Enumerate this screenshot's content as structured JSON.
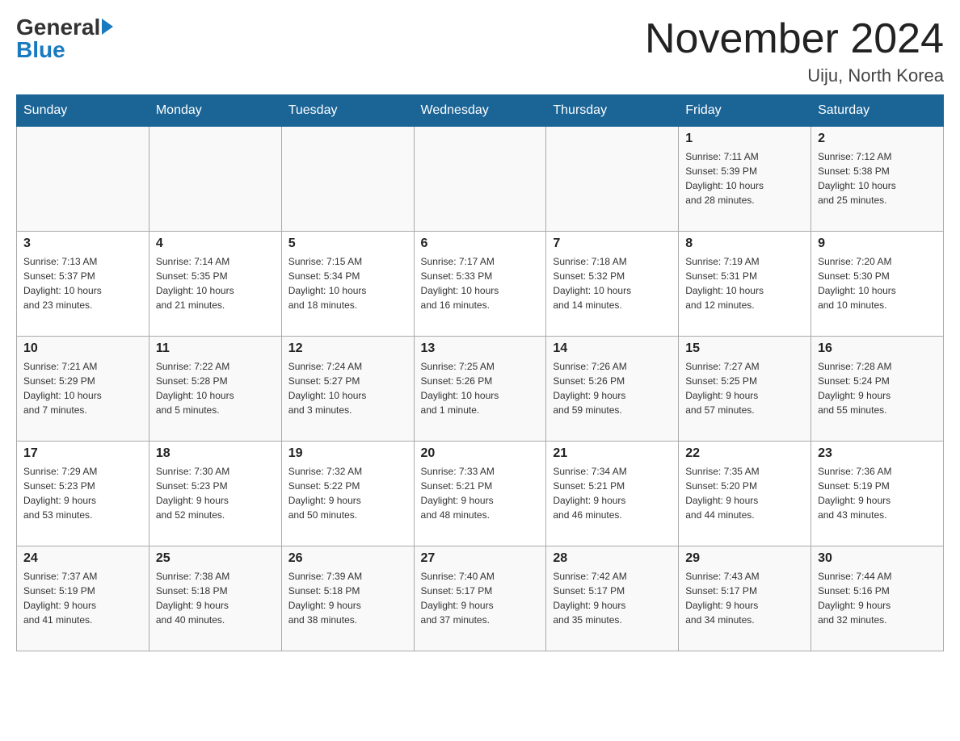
{
  "logo": {
    "general": "General",
    "blue": "Blue"
  },
  "title": "November 2024",
  "location": "Uiju, North Korea",
  "days_of_week": [
    "Sunday",
    "Monday",
    "Tuesday",
    "Wednesday",
    "Thursday",
    "Friday",
    "Saturday"
  ],
  "weeks": [
    [
      {
        "day": "",
        "info": ""
      },
      {
        "day": "",
        "info": ""
      },
      {
        "day": "",
        "info": ""
      },
      {
        "day": "",
        "info": ""
      },
      {
        "day": "",
        "info": ""
      },
      {
        "day": "1",
        "info": "Sunrise: 7:11 AM\nSunset: 5:39 PM\nDaylight: 10 hours\nand 28 minutes."
      },
      {
        "day": "2",
        "info": "Sunrise: 7:12 AM\nSunset: 5:38 PM\nDaylight: 10 hours\nand 25 minutes."
      }
    ],
    [
      {
        "day": "3",
        "info": "Sunrise: 7:13 AM\nSunset: 5:37 PM\nDaylight: 10 hours\nand 23 minutes."
      },
      {
        "day": "4",
        "info": "Sunrise: 7:14 AM\nSunset: 5:35 PM\nDaylight: 10 hours\nand 21 minutes."
      },
      {
        "day": "5",
        "info": "Sunrise: 7:15 AM\nSunset: 5:34 PM\nDaylight: 10 hours\nand 18 minutes."
      },
      {
        "day": "6",
        "info": "Sunrise: 7:17 AM\nSunset: 5:33 PM\nDaylight: 10 hours\nand 16 minutes."
      },
      {
        "day": "7",
        "info": "Sunrise: 7:18 AM\nSunset: 5:32 PM\nDaylight: 10 hours\nand 14 minutes."
      },
      {
        "day": "8",
        "info": "Sunrise: 7:19 AM\nSunset: 5:31 PM\nDaylight: 10 hours\nand 12 minutes."
      },
      {
        "day": "9",
        "info": "Sunrise: 7:20 AM\nSunset: 5:30 PM\nDaylight: 10 hours\nand 10 minutes."
      }
    ],
    [
      {
        "day": "10",
        "info": "Sunrise: 7:21 AM\nSunset: 5:29 PM\nDaylight: 10 hours\nand 7 minutes."
      },
      {
        "day": "11",
        "info": "Sunrise: 7:22 AM\nSunset: 5:28 PM\nDaylight: 10 hours\nand 5 minutes."
      },
      {
        "day": "12",
        "info": "Sunrise: 7:24 AM\nSunset: 5:27 PM\nDaylight: 10 hours\nand 3 minutes."
      },
      {
        "day": "13",
        "info": "Sunrise: 7:25 AM\nSunset: 5:26 PM\nDaylight: 10 hours\nand 1 minute."
      },
      {
        "day": "14",
        "info": "Sunrise: 7:26 AM\nSunset: 5:26 PM\nDaylight: 9 hours\nand 59 minutes."
      },
      {
        "day": "15",
        "info": "Sunrise: 7:27 AM\nSunset: 5:25 PM\nDaylight: 9 hours\nand 57 minutes."
      },
      {
        "day": "16",
        "info": "Sunrise: 7:28 AM\nSunset: 5:24 PM\nDaylight: 9 hours\nand 55 minutes."
      }
    ],
    [
      {
        "day": "17",
        "info": "Sunrise: 7:29 AM\nSunset: 5:23 PM\nDaylight: 9 hours\nand 53 minutes."
      },
      {
        "day": "18",
        "info": "Sunrise: 7:30 AM\nSunset: 5:23 PM\nDaylight: 9 hours\nand 52 minutes."
      },
      {
        "day": "19",
        "info": "Sunrise: 7:32 AM\nSunset: 5:22 PM\nDaylight: 9 hours\nand 50 minutes."
      },
      {
        "day": "20",
        "info": "Sunrise: 7:33 AM\nSunset: 5:21 PM\nDaylight: 9 hours\nand 48 minutes."
      },
      {
        "day": "21",
        "info": "Sunrise: 7:34 AM\nSunset: 5:21 PM\nDaylight: 9 hours\nand 46 minutes."
      },
      {
        "day": "22",
        "info": "Sunrise: 7:35 AM\nSunset: 5:20 PM\nDaylight: 9 hours\nand 44 minutes."
      },
      {
        "day": "23",
        "info": "Sunrise: 7:36 AM\nSunset: 5:19 PM\nDaylight: 9 hours\nand 43 minutes."
      }
    ],
    [
      {
        "day": "24",
        "info": "Sunrise: 7:37 AM\nSunset: 5:19 PM\nDaylight: 9 hours\nand 41 minutes."
      },
      {
        "day": "25",
        "info": "Sunrise: 7:38 AM\nSunset: 5:18 PM\nDaylight: 9 hours\nand 40 minutes."
      },
      {
        "day": "26",
        "info": "Sunrise: 7:39 AM\nSunset: 5:18 PM\nDaylight: 9 hours\nand 38 minutes."
      },
      {
        "day": "27",
        "info": "Sunrise: 7:40 AM\nSunset: 5:17 PM\nDaylight: 9 hours\nand 37 minutes."
      },
      {
        "day": "28",
        "info": "Sunrise: 7:42 AM\nSunset: 5:17 PM\nDaylight: 9 hours\nand 35 minutes."
      },
      {
        "day": "29",
        "info": "Sunrise: 7:43 AM\nSunset: 5:17 PM\nDaylight: 9 hours\nand 34 minutes."
      },
      {
        "day": "30",
        "info": "Sunrise: 7:44 AM\nSunset: 5:16 PM\nDaylight: 9 hours\nand 32 minutes."
      }
    ]
  ]
}
